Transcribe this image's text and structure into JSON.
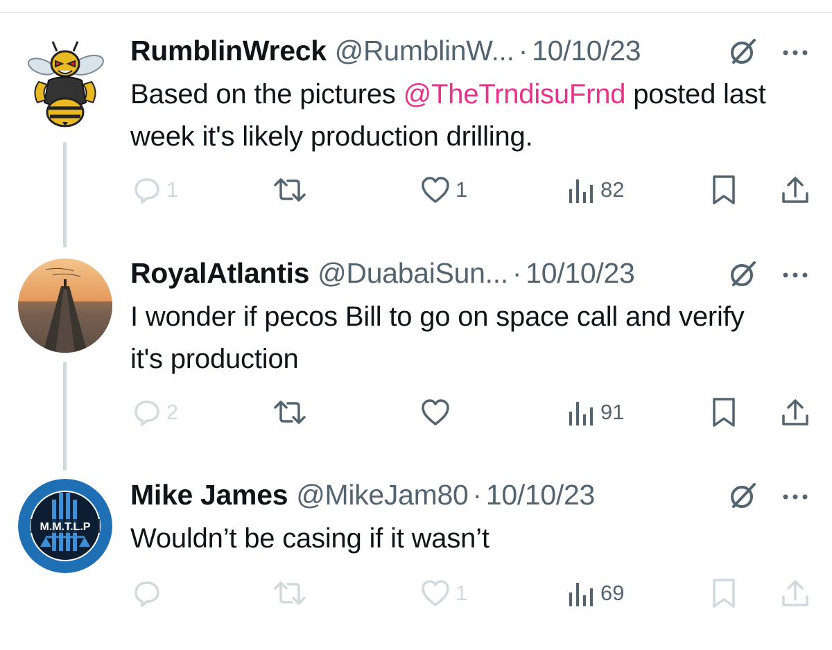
{
  "colors": {
    "text": "#0f1419",
    "secondary": "#536471",
    "mention": "#e8338b",
    "faded": "#cfd9de",
    "connector": "#cfd9de"
  },
  "tweets": [
    {
      "name": "RumblinWreck",
      "handle": "@RumblinW...",
      "separator": "·",
      "date": "10/10/23",
      "text_before": "Based on the pictures ",
      "mention": "@TheTrndisuFrnd",
      "text_after": " posted last week it's likely production drilling.",
      "replies": "1",
      "likes": "1",
      "views": "82",
      "avatar_icon": "hornet-mascot-avatar"
    },
    {
      "name": "RoyalAtlantis",
      "handle": "@DuabaiSun...",
      "separator": "·",
      "date": "10/10/23",
      "text": "I wonder if pecos Bill to go on space call and verify it's production",
      "replies": "2",
      "views": "91",
      "avatar_icon": "pier-sunset-avatar"
    },
    {
      "name": "Mike James",
      "handle": "@MikeJam80",
      "separator": "·",
      "date": "10/10/23",
      "text": "Wouldn’t be casing if it wasn’t",
      "likes": "1",
      "views": "69",
      "avatar_icon": "mmtlp-logo-avatar",
      "avatar_logo_text": "M.M.T.L.P"
    }
  ]
}
